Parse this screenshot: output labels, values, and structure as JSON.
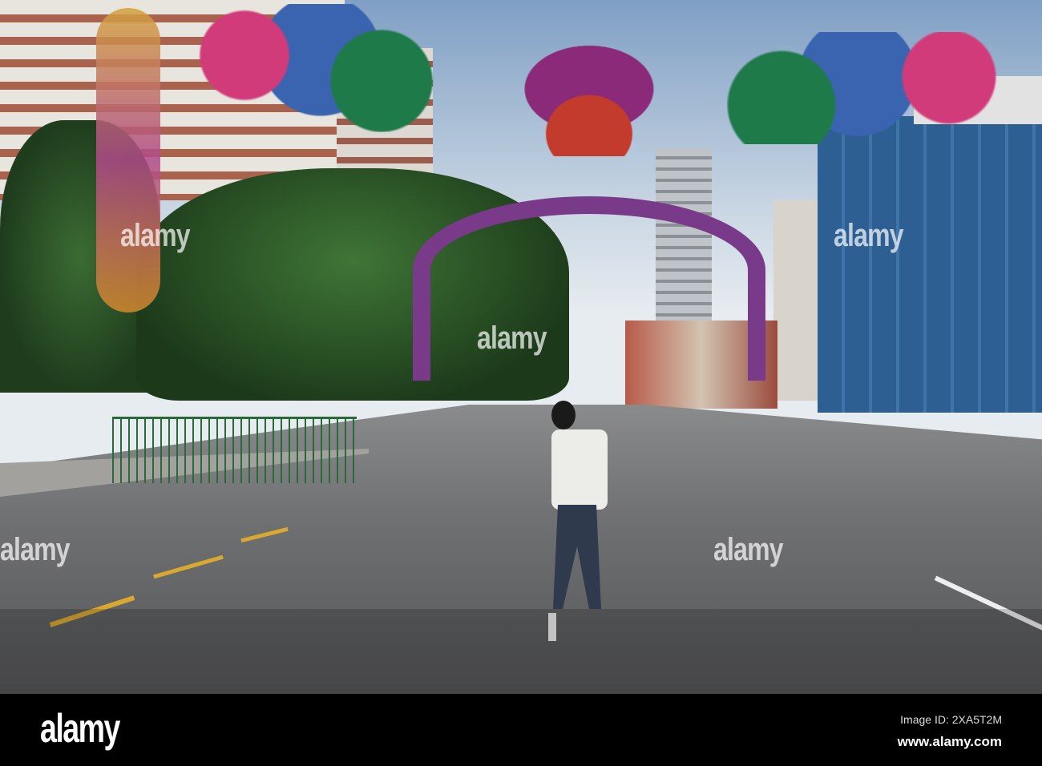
{
  "photo": {
    "description_alt": "Street scene",
    "watermark": "alamy"
  },
  "footer": {
    "logo": "alamy",
    "image_id": "Image ID: 2XA5T2M",
    "url": "www.alamy.com"
  },
  "colors": {
    "road": "#6f7072",
    "sky": "#c9d6e3",
    "trees": "#2f5a2c"
  }
}
